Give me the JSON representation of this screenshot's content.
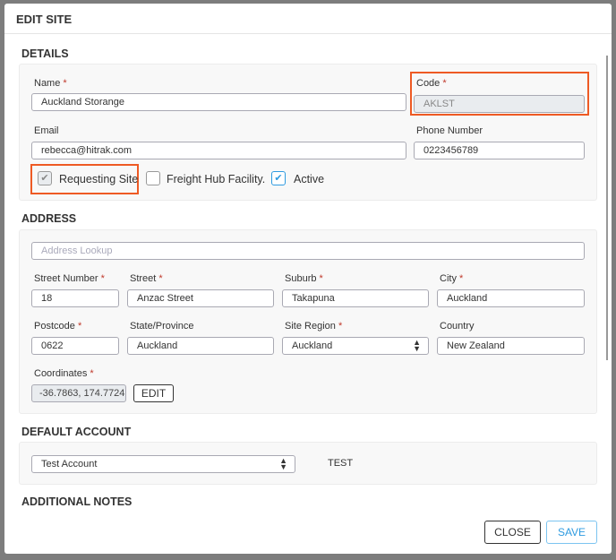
{
  "modal": {
    "title": "EDIT SITE"
  },
  "details": {
    "heading": "DETAILS",
    "name": {
      "label": "Name",
      "value": "Auckland Storange"
    },
    "code": {
      "label": "Code",
      "value": "AKLST"
    },
    "email": {
      "label": "Email",
      "value": "rebecca@hitrak.com"
    },
    "phone": {
      "label": "Phone Number",
      "value": "0223456789"
    },
    "checkboxes": [
      {
        "label": "Requesting Site",
        "checked": true,
        "disabled": true
      },
      {
        "label": "Freight Hub Facility.",
        "checked": false
      },
      {
        "label": "Active",
        "checked": true
      }
    ],
    "required_mark": "*"
  },
  "address": {
    "heading": "ADDRESS",
    "lookup_placeholder": "Address Lookup",
    "street_number": {
      "label": "Street Number",
      "value": "18"
    },
    "street": {
      "label": "Street",
      "value": "Anzac Street"
    },
    "suburb": {
      "label": "Suburb",
      "value": "Takapuna"
    },
    "city": {
      "label": "City",
      "value": "Auckland"
    },
    "postcode": {
      "label": "Postcode",
      "value": "0622"
    },
    "state": {
      "label": "State/Province",
      "value": "Auckland"
    },
    "site_region": {
      "label": "Site Region",
      "value": "Auckland"
    },
    "country": {
      "label": "Country",
      "value": "New Zealand"
    },
    "coordinates": {
      "label": "Coordinates",
      "value": "-36.7863, 174.7724"
    },
    "edit_label": "EDIT"
  },
  "default_account": {
    "heading": "DEFAULT ACCOUNT",
    "value": "Test Account",
    "code": "TEST"
  },
  "additional_notes": {
    "heading": "ADDITIONAL NOTES"
  },
  "footer": {
    "close": "CLOSE",
    "save": "SAVE"
  },
  "colors": {
    "highlight": "#ee5a24",
    "accent": "#2f9be0"
  }
}
